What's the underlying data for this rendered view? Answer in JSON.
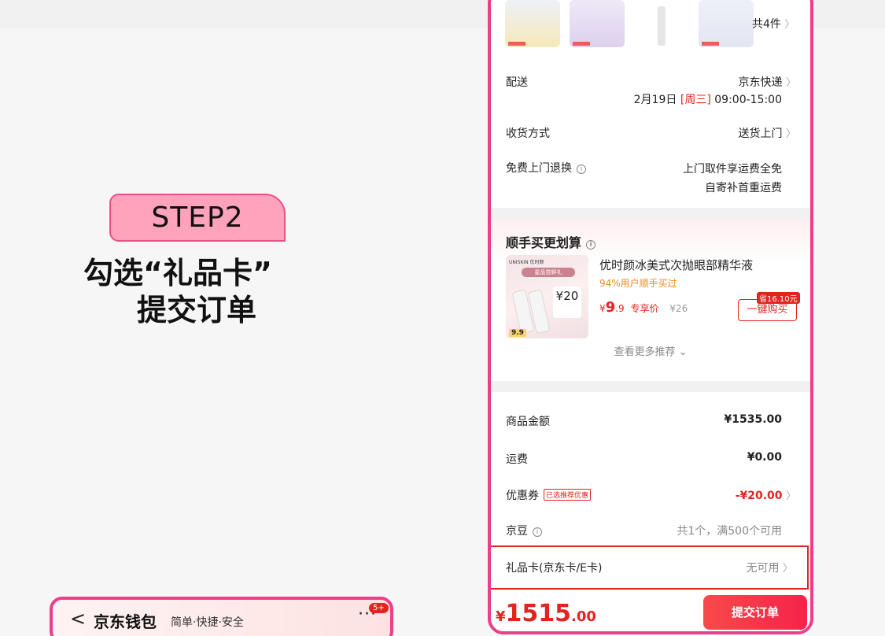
{
  "callout": {
    "step": "STEP2",
    "line1": "勾选“礼品卡”",
    "line2": "提交订单"
  },
  "wallet": {
    "back": "<",
    "title": "京东钱包",
    "subtitle": "简单·快捷·安全",
    "more": "···",
    "badge": "5+"
  },
  "order": {
    "item_count": "共4件",
    "delivery": {
      "label": "配送",
      "carrier": "京东快递",
      "date": "2月19日",
      "weekday": "[周三]",
      "time": "09:00-15:00"
    },
    "receive": {
      "label": "收货方式",
      "value": "送货上门"
    },
    "returns": {
      "label": "免费上门退换",
      "line1": "上门取件享运费全免",
      "line2": "自寄补首重运费"
    },
    "upsell": {
      "heading": "顺手买更划算",
      "image_brand": "UNISKIN 优时颜",
      "image_pill": "星品尝鲜礼",
      "image_coupon": "¥20",
      "image_price": "9.9",
      "title": "优时颜冰美式次抛眼部精华液",
      "hint": "94%用户顺手买过",
      "price_symbol": "¥",
      "price_int": "9",
      "price_dec": ".9",
      "price_tag": "专享价",
      "orig_price": "¥26",
      "save_tag": "省16.10元",
      "buy_label": "一键购买",
      "more": "查看更多推荐 ⌄"
    },
    "summary": {
      "goods_label": "商品金额",
      "goods_value": "¥1535.00",
      "shipping_label": "运费",
      "shipping_value": "¥0.00",
      "coupon_label": "优惠券",
      "coupon_tag": "已选推荐优惠",
      "coupon_value": "-¥20.00",
      "beans_label": "京豆",
      "beans_value": "共1个，满500个可用",
      "giftcard_label": "礼品卡(京东卡/E卡)",
      "giftcard_value": "无可用"
    },
    "total": {
      "symbol": "¥",
      "int": "1515",
      "dec": ".00"
    },
    "submit": "提交订单"
  },
  "colors": {
    "accent": "#e4231f",
    "highlight": "#ea3f8a",
    "badge_fill": "#ffa3bd"
  }
}
